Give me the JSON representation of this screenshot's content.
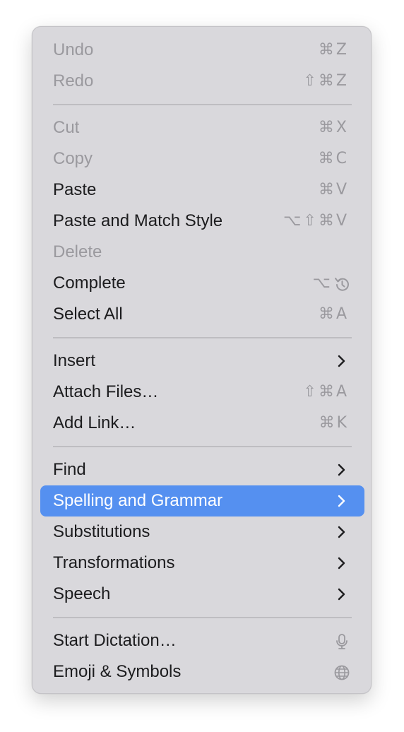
{
  "menu": {
    "items": [
      {
        "label": "Undo",
        "shortcut": "⌘Z",
        "disabled": true
      },
      {
        "label": "Redo",
        "shortcut": "⇧⌘Z",
        "disabled": true
      },
      {
        "label": "Cut",
        "shortcut": "⌘X",
        "disabled": true
      },
      {
        "label": "Copy",
        "shortcut": "⌘C",
        "disabled": true
      },
      {
        "label": "Paste",
        "shortcut": "⌘V",
        "disabled": false
      },
      {
        "label": "Paste and Match Style",
        "shortcut": "⌥⇧⌘V",
        "disabled": false
      },
      {
        "label": "Delete",
        "shortcut": "",
        "disabled": true
      },
      {
        "label": "Complete",
        "shortcut": "⌥",
        "shortcut_icon": "escape-key-icon",
        "disabled": false
      },
      {
        "label": "Select All",
        "shortcut": "⌘A",
        "disabled": false
      },
      {
        "label": "Insert",
        "submenu": true
      },
      {
        "label": "Attach Files…",
        "shortcut": "⇧⌘A",
        "disabled": false
      },
      {
        "label": "Add Link…",
        "shortcut": "⌘K",
        "disabled": false
      },
      {
        "label": "Find",
        "submenu": true
      },
      {
        "label": "Spelling and Grammar",
        "submenu": true,
        "highlighted": true
      },
      {
        "label": "Substitutions",
        "submenu": true
      },
      {
        "label": "Transformations",
        "submenu": true
      },
      {
        "label": "Speech",
        "submenu": true
      },
      {
        "label": "Start Dictation…",
        "shortcut_icon": "microphone-icon"
      },
      {
        "label": "Emoji & Symbols",
        "shortcut_icon": "globe-icon"
      }
    ]
  },
  "colors": {
    "menu_background": "#d9d8dc",
    "highlight": "#5590f0",
    "text": "#1c1c1e",
    "disabled_text": "#9a999e",
    "separator": "#bebdc1"
  }
}
